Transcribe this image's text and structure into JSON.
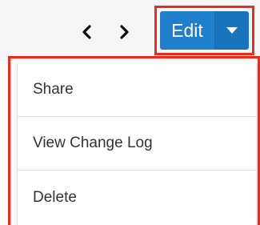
{
  "toolbar": {
    "prev_icon": "chevron-left-icon",
    "next_icon": "chevron-right-icon",
    "edit_label": "Edit",
    "caret_icon": "caret-down-icon",
    "accent_color": "#1f7fcd"
  },
  "menu": {
    "items": [
      {
        "label": "Share"
      },
      {
        "label": "View Change Log"
      },
      {
        "label": "Delete"
      }
    ]
  },
  "highlight_color": "#ee2a1b"
}
